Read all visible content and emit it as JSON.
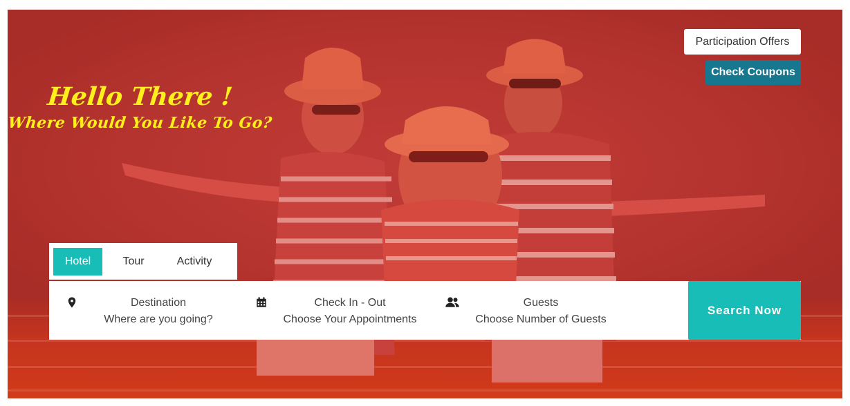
{
  "hero": {
    "greeting_title": "Hello There !",
    "greeting_subtitle": "Where Would You Like To Go?",
    "overlay_color": "#b8362f",
    "greeting_color": "#ffef1a"
  },
  "top_actions": {
    "offers_label": "Participation Offers",
    "coupons_label": "Check Coupons",
    "coupons_color": "#16778f"
  },
  "tabs": [
    {
      "label": "Hotel",
      "active": true
    },
    {
      "label": "Tour",
      "active": false
    },
    {
      "label": "Activity",
      "active": false
    }
  ],
  "search": {
    "destination": {
      "icon": "map-marker-icon",
      "title": "Destination",
      "subtitle": "Where are you going?"
    },
    "dates": {
      "icon": "calendar-icon",
      "title": "Check In - Out",
      "subtitle": "Choose Your Appointments"
    },
    "guests": {
      "icon": "users-icon",
      "title": "Guests",
      "subtitle": "Choose Number of Guests"
    },
    "button_label": "Search Now",
    "accent_color": "#18bdb8"
  }
}
